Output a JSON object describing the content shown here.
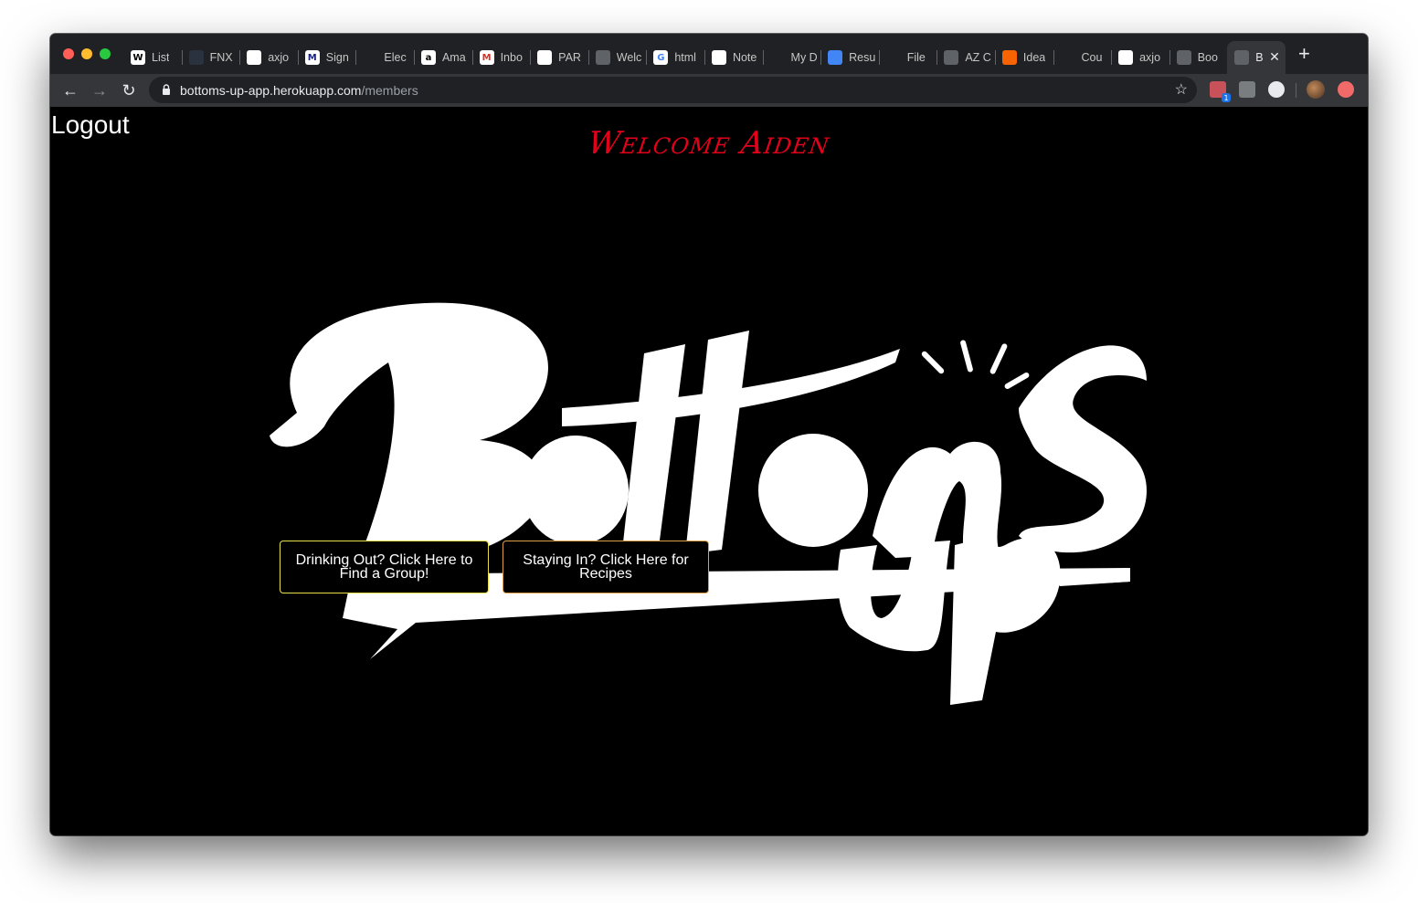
{
  "browser": {
    "tabs": [
      {
        "title": "List",
        "icon": "wikipedia-icon",
        "glyph": "W",
        "color": "#ffffff",
        "fg": "#000000"
      },
      {
        "title": "FNX",
        "icon": "fnx-icon",
        "glyph": "",
        "color": "#2a3240",
        "fg": "#ffffff"
      },
      {
        "title": "axjo",
        "icon": "github-icon",
        "glyph": "",
        "color": "#ffffff",
        "fg": "#000000"
      },
      {
        "title": "Sign",
        "icon": "m-icon",
        "glyph": "M",
        "color": "#ffffff",
        "fg": "#1a237e"
      },
      {
        "title": "Elec",
        "icon": "bars-icon",
        "glyph": "",
        "color": "#202124",
        "fg": "#ffffff"
      },
      {
        "title": "Ama",
        "icon": "amazon-icon",
        "glyph": "a",
        "color": "#ffffff",
        "fg": "#000000"
      },
      {
        "title": "Inbo",
        "icon": "gmail-icon",
        "glyph": "M",
        "color": "#ffffff",
        "fg": "#d93025"
      },
      {
        "title": "PAR",
        "icon": "par-icon",
        "glyph": "",
        "color": "#ffffff",
        "fg": "#000000"
      },
      {
        "title": "Welc",
        "icon": "globe-icon",
        "glyph": "",
        "color": "#5f6368",
        "fg": "#ffffff"
      },
      {
        "title": "html",
        "icon": "google-icon",
        "glyph": "G",
        "color": "#ffffff",
        "fg": "#4285f4"
      },
      {
        "title": "Note",
        "icon": "github-icon",
        "glyph": "",
        "color": "#ffffff",
        "fg": "#000000"
      },
      {
        "title": "My D",
        "icon": "drive-icon",
        "glyph": "",
        "color": "#202124",
        "fg": "#ffffff"
      },
      {
        "title": "Resu",
        "icon": "docs-icon",
        "glyph": "",
        "color": "#4285f4",
        "fg": "#ffffff"
      },
      {
        "title": "File",
        "icon": "bars-icon",
        "glyph": "",
        "color": "#202124",
        "fg": "#ffffff"
      },
      {
        "title": "AZ C",
        "icon": "globe-icon",
        "glyph": "",
        "color": "#5f6368",
        "fg": "#ffffff"
      },
      {
        "title": "Idea",
        "icon": "home-depot-icon",
        "glyph": "",
        "color": "#f96302",
        "fg": "#ffffff"
      },
      {
        "title": "Cou",
        "icon": "shield-icon",
        "glyph": "",
        "color": "#202124",
        "fg": "#5b8def"
      },
      {
        "title": "axjo",
        "icon": "github-icon",
        "glyph": "",
        "color": "#ffffff",
        "fg": "#000000"
      },
      {
        "title": "Boo",
        "icon": "globe-icon",
        "glyph": "",
        "color": "#5f6368",
        "fg": "#ffffff"
      },
      {
        "title": "B",
        "icon": "globe-icon",
        "glyph": "",
        "color": "#5f6368",
        "fg": "#ffffff",
        "active": true
      }
    ],
    "close_tab": "✕",
    "new_tab": "+",
    "back": "←",
    "forward": "→",
    "reload": "↻",
    "url_host": "bottoms-up-app.herokuapp.com",
    "url_path": "/members",
    "bookmark_star": "☆",
    "extension_badge": "1"
  },
  "page": {
    "logout": "Logout",
    "welcome": "Welcome Aiden",
    "logo_alt": "Bottoms up",
    "drinking_out_button": "Drinking Out? Click Here to Find a Group!",
    "staying_in_button": "Staying In? Click Here for Recipes",
    "accent_color": "#e3001b"
  }
}
